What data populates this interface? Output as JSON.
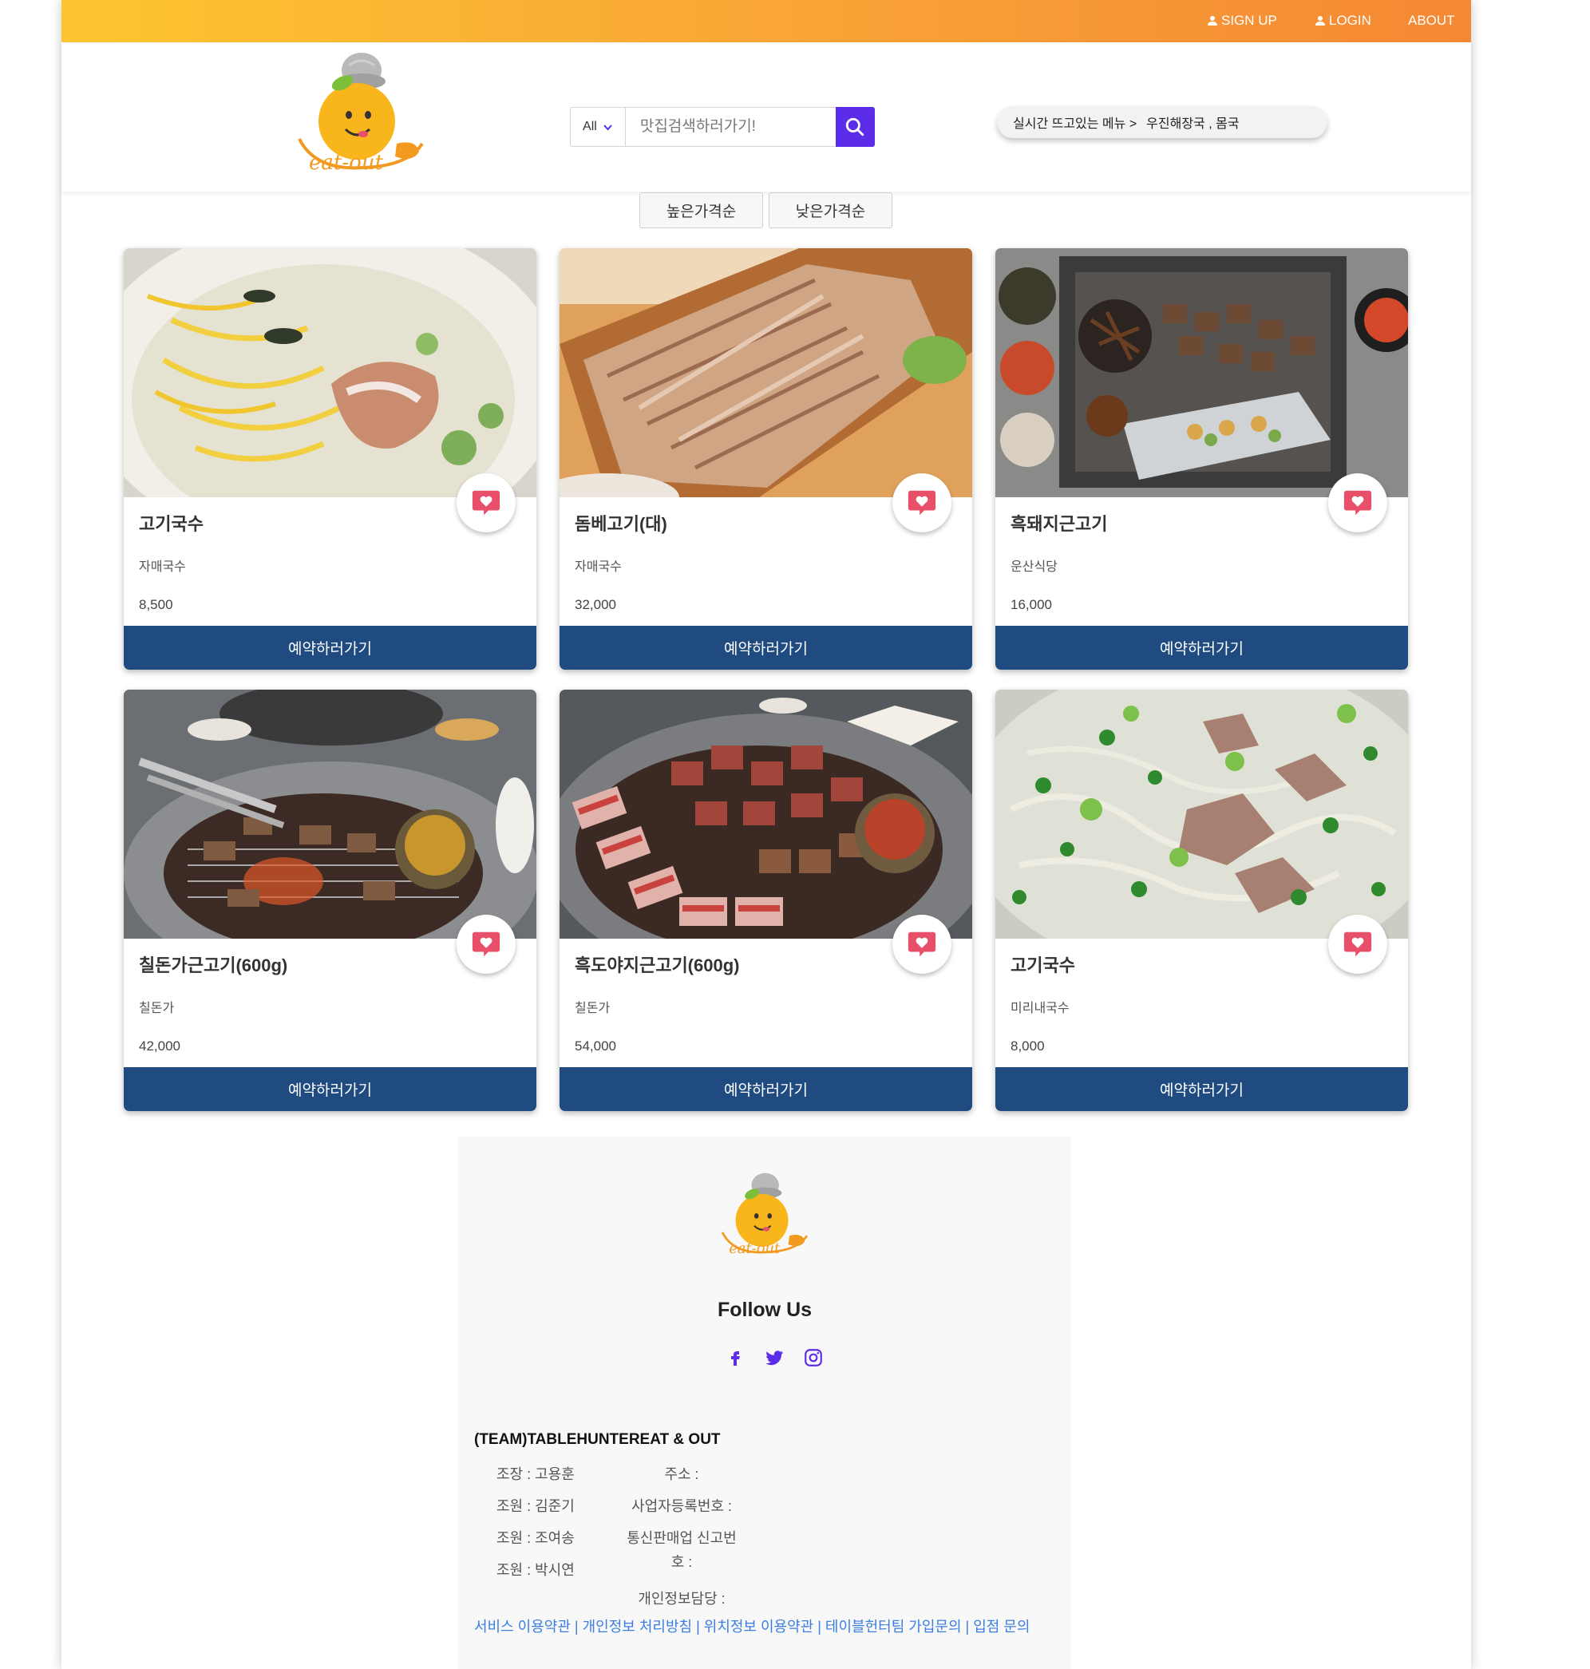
{
  "topnav": {
    "signup": "SIGN UP",
    "login": "LOGIN",
    "about": "ABOUT"
  },
  "search": {
    "category": "All",
    "placeholder": "맛집검색하러가기!"
  },
  "trending": {
    "label": "실시간 뜨고있는 메뉴 >",
    "items": "우진해장국 , 몸국"
  },
  "sort": {
    "high": "높은가격순",
    "low": "낮은가격순"
  },
  "cards": [
    {
      "title": "고기국수",
      "shop": "자매국수",
      "price": "8,500",
      "button": "예약하러가기"
    },
    {
      "title": "돔베고기(대)",
      "shop": "자매국수",
      "price": "32,000",
      "button": "예약하러가기"
    },
    {
      "title": "흑돼지근고기",
      "shop": "운산식당",
      "price": "16,000",
      "button": "예약하러가기"
    },
    {
      "title": "칠돈가근고기(600g)",
      "shop": "칠돈가",
      "price": "42,000",
      "button": "예약하러가기"
    },
    {
      "title": "흑도야지근고기(600g)",
      "shop": "칠돈가",
      "price": "54,000",
      "button": "예약하러가기"
    },
    {
      "title": "고기국수",
      "shop": "미리내국수",
      "price": "8,000",
      "button": "예약하러가기"
    }
  ],
  "footer": {
    "follow": "Follow Us",
    "team": "(TEAM)TABLEHUNTEREAT & OUT",
    "members": [
      "조장 : 고용훈",
      "조원 : 김준기",
      "조원 : 조여송",
      "조원 : 박시연"
    ],
    "info": [
      "주소 :",
      "사업자등록번호 :",
      "통신판매업 신고번",
      "호 :",
      "개인정보담당 :"
    ],
    "terms": "서비스 이용약관 | 개인정보 처리방침 | 위치정보 이용약관 | 테이블헌터팀 가입문의 | 입점 문의"
  },
  "colors": {
    "topbar_start": "#fdc52f",
    "topbar_end": "#f58834",
    "search_button": "#5b2de8",
    "card_button": "#1f4b80",
    "heart": "#e8506a",
    "social": "#5b2de8",
    "terms_link": "#3b7ee0"
  },
  "icons": [
    "user-icon",
    "chevron-down-icon",
    "search-icon",
    "heart-icon",
    "facebook-icon",
    "twitter-icon",
    "instagram-icon"
  ]
}
